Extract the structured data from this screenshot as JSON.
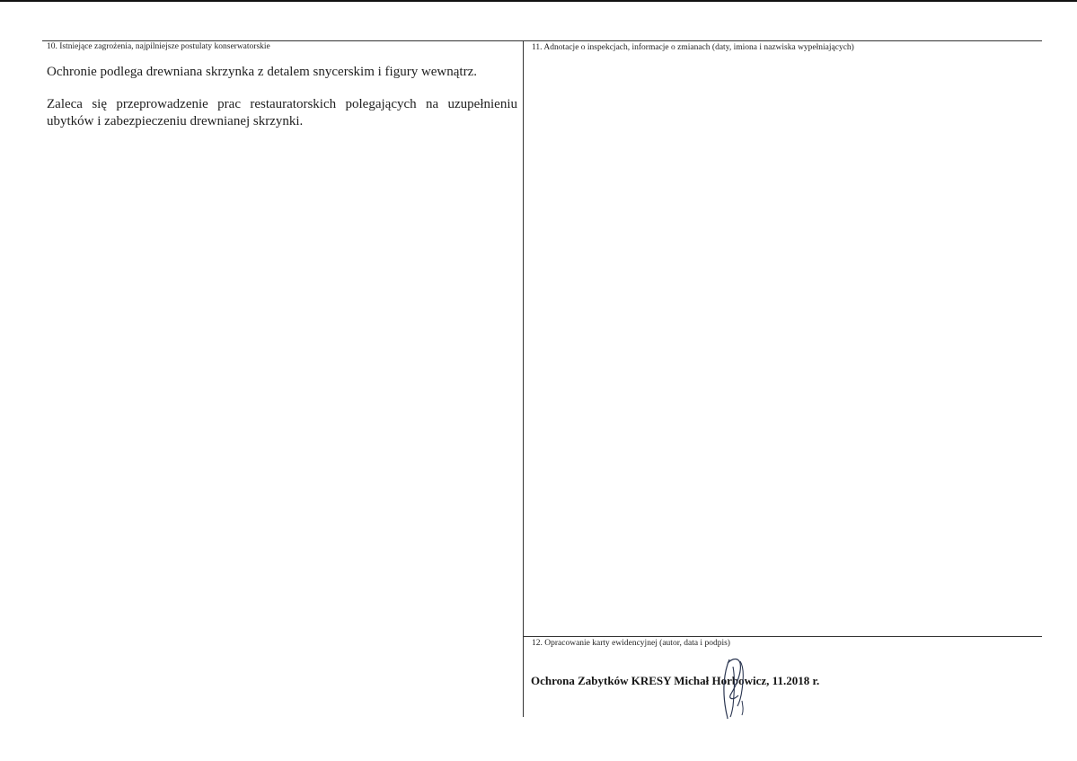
{
  "section10": {
    "label": "10. Istniejące zagrożenia, najpilniejsze postulaty konserwatorskie",
    "paragraph1": "Ochronie podlega drewniana skrzynka z detalem snycerskim i figury wewnątrz.",
    "paragraph2": "Zaleca się przeprowadzenie prac restauratorskich polegających na uzupełnieniu ubytków i zabezpieczeniu drewnianej skrzynki."
  },
  "section11": {
    "label": "11. Adnotacje o inspekcjach, informacje o zmianach (daty, imiona i nazwiska wypełniających)"
  },
  "section12": {
    "label": "12. Opracowanie karty ewidencyjnej (autor, data i podpis)",
    "author_line": "Ochrona Zabytków KRESY Michał Horbowicz, 11.2018 r."
  }
}
